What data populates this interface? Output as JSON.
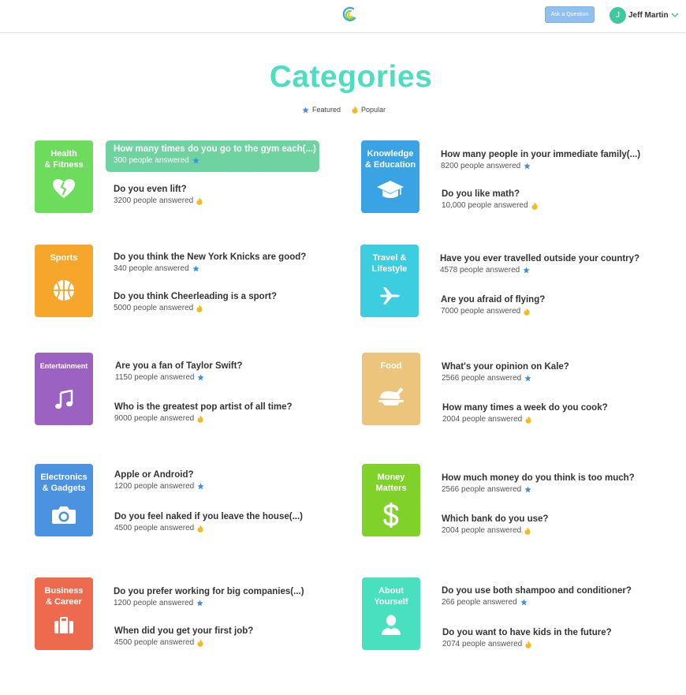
{
  "header": {
    "ask_button": "Ask a Question",
    "user_initial": "J",
    "user_name": "Jeff Martin"
  },
  "page": {
    "title": "Categories",
    "legend_featured": "Featured",
    "legend_popular": "Popular"
  },
  "colors": {
    "title": "#4fdcc0",
    "featured_star": "#3a8fe0",
    "popular_flame": "#f5b81e",
    "highlight_row": "#6ed3a0"
  },
  "categories": [
    {
      "name": "Health\n& Fitness",
      "color": "#6ddb5c",
      "icon": "broken-heart-icon",
      "questions": [
        {
          "text": "How many times do you go to the gym each(...)",
          "answered": "300 people answered",
          "badge": "featured",
          "highlighted": true
        },
        {
          "text": "Do you even lift?",
          "answered": "3200 people answered",
          "badge": "popular"
        }
      ]
    },
    {
      "name": "Knowledge\n& Education",
      "color": "#3aa3e3",
      "icon": "graduation-cap-icon",
      "questions": [
        {
          "text": "How many people in your immediate family(...)",
          "answered": "8200 people answered",
          "badge": "featured"
        },
        {
          "text": "Do you like math?",
          "answered": "10,000 people answered",
          "badge": "popular"
        }
      ]
    },
    {
      "name": "Sports",
      "color": "#f5a62b",
      "icon": "basketball-icon",
      "questions": [
        {
          "text": "Do you think the New York Knicks are good?",
          "answered": "340 people answered",
          "badge": "featured"
        },
        {
          "text": "Do you think Cheerleading is a sport?",
          "answered": "5000 people answered",
          "badge": "popular"
        }
      ]
    },
    {
      "name": "Travel &\nLifestyle",
      "color": "#3dcde0",
      "icon": "airplane-icon",
      "questions": [
        {
          "text": "Have you ever travelled outside your country?",
          "answered": "4578 people answered",
          "badge": "featured"
        },
        {
          "text": "Are you afraid of flying?",
          "answered": "7000 people answered",
          "badge": "popular"
        }
      ]
    },
    {
      "name": "Entertainment",
      "color": "#9b62c2",
      "icon": "music-note-icon",
      "questions": [
        {
          "text": "Are you a fan of Taylor Swift?",
          "answered": "1150 people answered",
          "badge": "featured"
        },
        {
          "text": "Who is the greatest pop artist of all time?",
          "answered": "9000 people answered",
          "badge": "popular"
        }
      ]
    },
    {
      "name": "Food",
      "color": "#ecc47c",
      "icon": "roast-chicken-icon",
      "questions": [
        {
          "text": "What's your opinion on Kale?",
          "answered": "2566 people answered",
          "badge": "featured"
        },
        {
          "text": "How many times a week do you cook?",
          "answered": "2004 people answered",
          "badge": "popular"
        }
      ]
    },
    {
      "name": "Electronics\n& Gadgets",
      "color": "#4b93e0",
      "icon": "camera-icon",
      "questions": [
        {
          "text": "Apple or Android?",
          "answered": "1200 people answered",
          "badge": "featured"
        },
        {
          "text": "Do you feel naked if you leave the house(...)",
          "answered": "4500 people answered",
          "badge": "popular"
        }
      ]
    },
    {
      "name": "Money\nMatters",
      "color": "#80d22a",
      "icon": "dollar-icon",
      "questions": [
        {
          "text": "How much money do you think is too much?",
          "answered": "2566 people answered",
          "badge": "featured"
        },
        {
          "text": "Which bank do you use?",
          "answered": "2004 people answered",
          "badge": "popular"
        }
      ]
    },
    {
      "name": "Business\n& Career",
      "color": "#ee6a4e",
      "icon": "briefcase-icon",
      "questions": [
        {
          "text": "Do you prefer working for big companies(...)",
          "answered": "1200 people answered",
          "badge": "featured"
        },
        {
          "text": "When did you get your first job?",
          "answered": "4500 people answered",
          "badge": "popular"
        }
      ]
    },
    {
      "name": "About\nYourself",
      "color": "#49e0bf",
      "icon": "person-icon",
      "questions": [
        {
          "text": "Do you use both shampoo and conditioner?",
          "answered": "266 people answered",
          "badge": "featured"
        },
        {
          "text": "Do you want to have kids in the future?",
          "answered": "2074 people answered",
          "badge": "popular"
        }
      ]
    }
  ]
}
